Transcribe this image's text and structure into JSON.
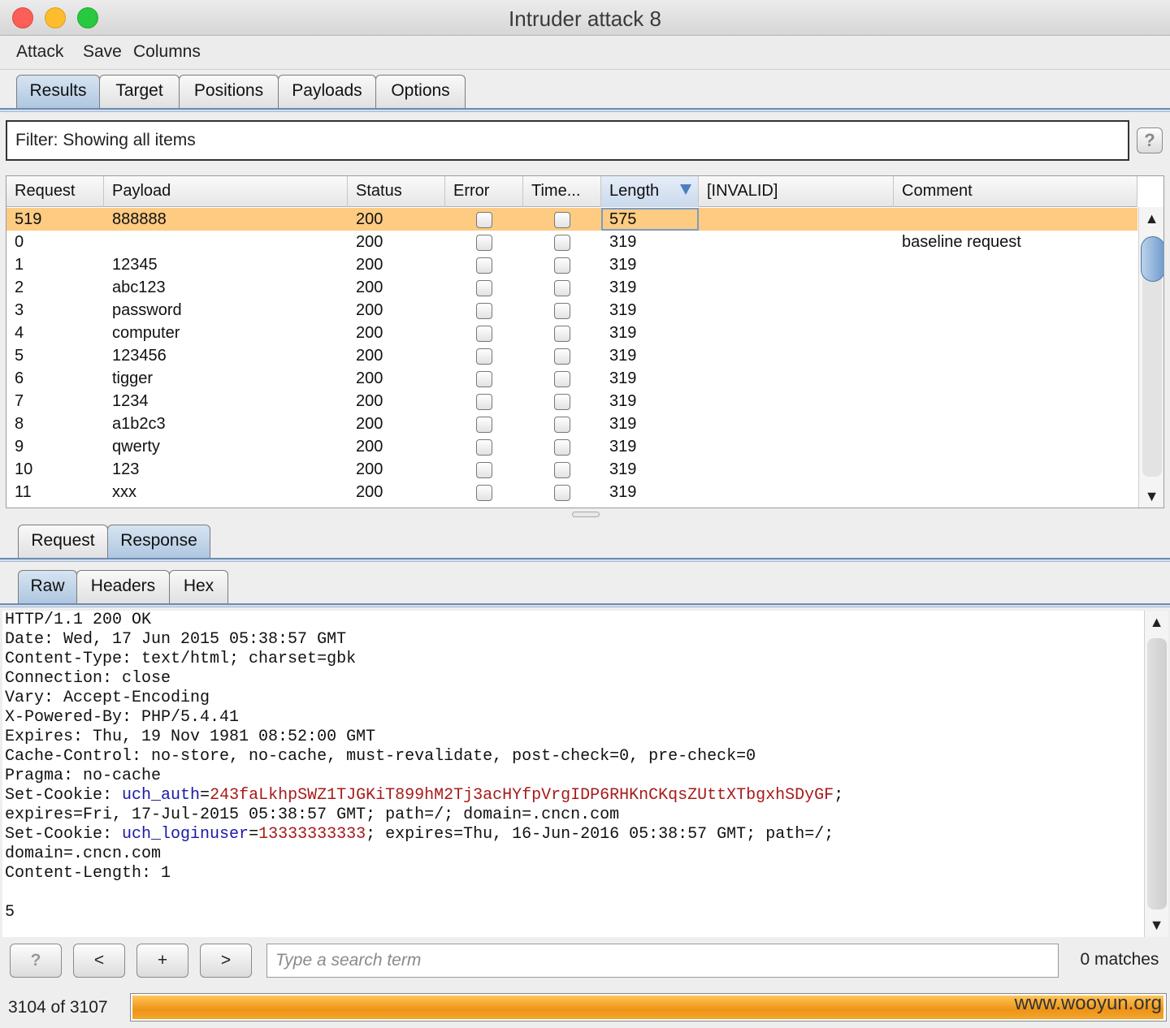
{
  "window": {
    "title": "Intruder attack 8"
  },
  "menu": [
    "Attack",
    "Save",
    "Columns"
  ],
  "tabs": [
    "Results",
    "Target",
    "Positions",
    "Payloads",
    "Options"
  ],
  "filter": {
    "text": "Filter:  Showing all items",
    "help": "?"
  },
  "table": {
    "columns": [
      "Request",
      "Payload",
      "Status",
      "Error",
      "Time...",
      "Length",
      "[INVALID]",
      "Comment"
    ],
    "rows": [
      {
        "request": "519",
        "payload": "888888",
        "status": "200",
        "error": false,
        "timeout": false,
        "length": "575",
        "invalid": "",
        "comment": ""
      },
      {
        "request": "0",
        "payload": "",
        "status": "200",
        "error": false,
        "timeout": false,
        "length": "319",
        "invalid": "",
        "comment": "baseline request"
      },
      {
        "request": "1",
        "payload": "12345",
        "status": "200",
        "error": false,
        "timeout": false,
        "length": "319",
        "invalid": "",
        "comment": ""
      },
      {
        "request": "2",
        "payload": "abc123",
        "status": "200",
        "error": false,
        "timeout": false,
        "length": "319",
        "invalid": "",
        "comment": ""
      },
      {
        "request": "3",
        "payload": "password",
        "status": "200",
        "error": false,
        "timeout": false,
        "length": "319",
        "invalid": "",
        "comment": ""
      },
      {
        "request": "4",
        "payload": "computer",
        "status": "200",
        "error": false,
        "timeout": false,
        "length": "319",
        "invalid": "",
        "comment": ""
      },
      {
        "request": "5",
        "payload": "123456",
        "status": "200",
        "error": false,
        "timeout": false,
        "length": "319",
        "invalid": "",
        "comment": ""
      },
      {
        "request": "6",
        "payload": "tigger",
        "status": "200",
        "error": false,
        "timeout": false,
        "length": "319",
        "invalid": "",
        "comment": ""
      },
      {
        "request": "7",
        "payload": "1234",
        "status": "200",
        "error": false,
        "timeout": false,
        "length": "319",
        "invalid": "",
        "comment": ""
      },
      {
        "request": "8",
        "payload": "a1b2c3",
        "status": "200",
        "error": false,
        "timeout": false,
        "length": "319",
        "invalid": "",
        "comment": ""
      },
      {
        "request": "9",
        "payload": "qwerty",
        "status": "200",
        "error": false,
        "timeout": false,
        "length": "319",
        "invalid": "",
        "comment": ""
      },
      {
        "request": "10",
        "payload": "123",
        "status": "200",
        "error": false,
        "timeout": false,
        "length": "319",
        "invalid": "",
        "comment": ""
      },
      {
        "request": "11",
        "payload": "xxx",
        "status": "200",
        "error": false,
        "timeout": false,
        "length": "319",
        "invalid": "",
        "comment": ""
      }
    ]
  },
  "detail_tabs": [
    "Request",
    "Response"
  ],
  "view_tabs": [
    "Raw",
    "Headers",
    "Hex"
  ],
  "response": {
    "status_line": "HTTP/1.1 200 OK",
    "date": "Date: Wed, 17 Jun 2015 05:38:57 GMT",
    "content_type": "Content-Type: text/html; charset=gbk",
    "connection": "Connection: close",
    "vary": "Vary: Accept-Encoding",
    "powered_by": "X-Powered-By: PHP/5.4.41",
    "expires": "Expires: Thu, 19 Nov 1981 08:52:00 GMT",
    "cache_control": "Cache-Control: no-store, no-cache, must-revalidate, post-check=0, pre-check=0",
    "pragma": "Pragma: no-cache",
    "cookie1_prefix": "Set-Cookie: ",
    "cookie1_name": "uch_auth",
    "cookie1_eq": "=",
    "cookie1_value": "243faLkhpSWZ1TJGKiT899hM2Tj3acHYfpVrgIDP6RHKnCKqsZUttXTbgxhSDyGF",
    "cookie1_suffix": ";",
    "cookie1_line2": "expires=Fri, 17-Jul-2015 05:38:57 GMT; path=/; domain=.cncn.com",
    "cookie2_prefix": "Set-Cookie: ",
    "cookie2_name": "uch_loginuser",
    "cookie2_eq": "=",
    "cookie2_value": "13333333333",
    "cookie2_suffix": "; expires=Thu, 16-Jun-2016 05:38:57 GMT; path=/;",
    "cookie2_line2": "domain=.cncn.com",
    "content_length": "Content-Length: 1",
    "body": "5"
  },
  "search": {
    "help": "?",
    "prev": "<",
    "add": "+",
    "next": ">",
    "placeholder": "Type a search term",
    "matches": "0 matches"
  },
  "progress": {
    "label": "3104 of 3107",
    "fraction": 0.999
  },
  "watermark": "www.wooyun.org",
  "colors": {
    "selected_row": "#fdcb82",
    "progress": "#ee9416",
    "cookie_name": "#1a1aa6",
    "cookie_value": "#a81a1a"
  }
}
